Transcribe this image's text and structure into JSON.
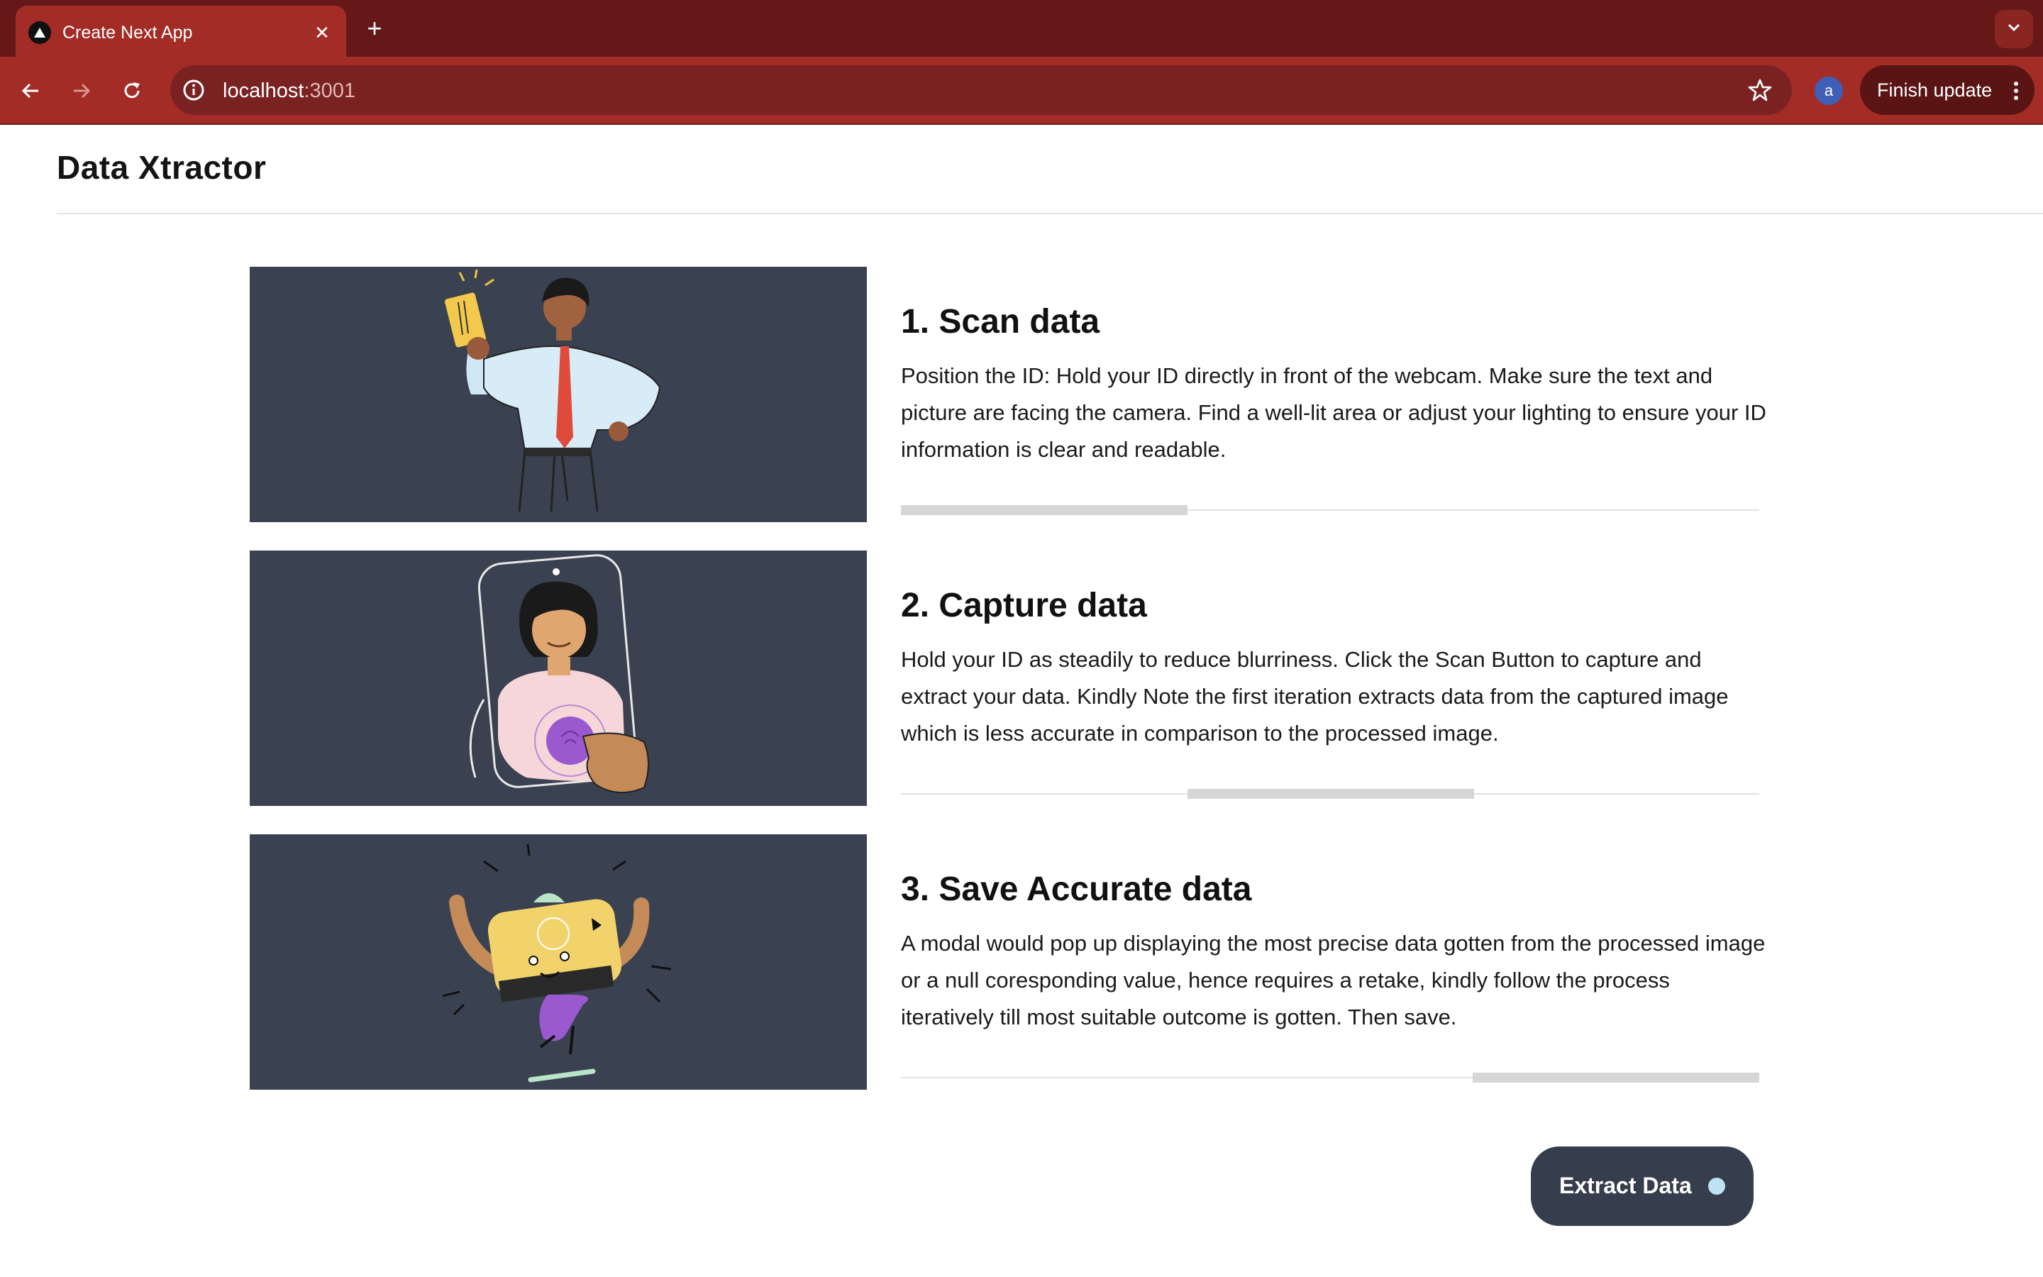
{
  "browser": {
    "tab_title": "Create Next App",
    "tab_close_icon": "close-icon",
    "new_tab_icon": "plus-icon",
    "url_host": "localhost",
    "url_port": ":3001",
    "profile_initial": "a",
    "finish_update_label": "Finish update",
    "theme_color": "#a32c27"
  },
  "app": {
    "title": "Data Xtractor"
  },
  "steps": [
    {
      "title": "1. Scan data",
      "text": "Position the ID: Hold your ID directly in front of the webcam. Make sure the text and picture are facing the camera. Find a well-lit area or adjust your lighting to ensure your ID information is clear and readable.",
      "illustration": "man-holding-id-card-illustration",
      "progress_segment": 1
    },
    {
      "title": "2. Capture data",
      "text": "Hold your ID as steadily to reduce blurriness. Click the Scan Button to capture and extract your data. Kindly Note the first iteration extracts data from the captured image which is less accurate in comparison to the processed image.",
      "illustration": "woman-in-phone-fingerprint-illustration",
      "progress_segment": 2
    },
    {
      "title": "3. Save Accurate data",
      "text": "A modal would pop up displaying the most precise data gotten from the processed image or a null coresponding value, hence requires a retake, kindly follow the process iteratively till most suitable outcome is gotten. Then save.",
      "illustration": "happy-yellow-character-illustration",
      "progress_segment": 3
    }
  ],
  "extract_button": {
    "label": "Extract Data",
    "color": "#363d4d"
  }
}
